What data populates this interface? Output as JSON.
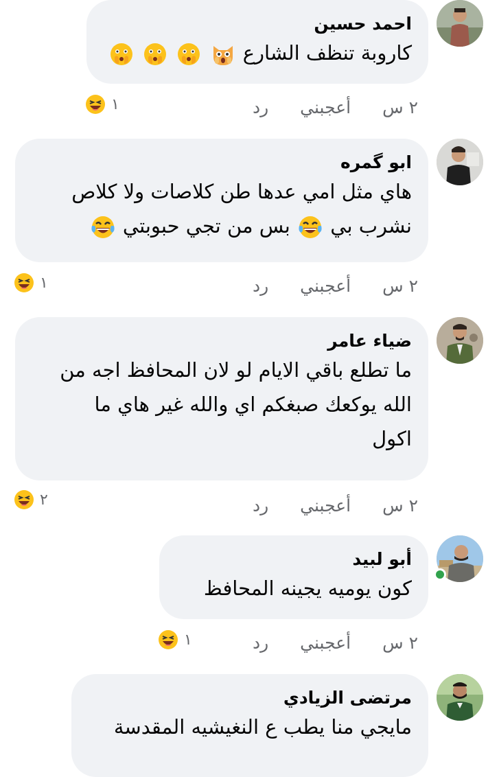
{
  "colors": {
    "bubble": "#f0f2f5",
    "meta": "#65676b",
    "online": "#31a24c"
  },
  "comments": [
    {
      "author": "احمد حسين",
      "lines": [
        "كاروبة تنظف الشارع"
      ],
      "emojis_after": [
        "shocked-cat-emoji",
        "face-hand-over-mouth-emoji",
        "face-hand-over-mouth-emoji",
        "face-hand-over-mouth-emoji"
      ],
      "time": "٢ س",
      "like": "أعجبني",
      "reply": "رد",
      "reaction_count": "١",
      "reaction_icon": "laughing-squint-emoji"
    },
    {
      "author": "ابو گمره",
      "lines": [
        "هاي مثل امي عدها طن كلاصات ولا كلاص",
        "نشرب بي",
        "بس من تجي حبوبتي"
      ],
      "emojis_inline": [
        "tears-of-joy-emoji",
        "tears-of-joy-emoji"
      ],
      "time": "٢ س",
      "like": "أعجبني",
      "reply": "رد",
      "reaction_count": "١",
      "reaction_icon": "laughing-squint-emoji"
    },
    {
      "author": "ضياء عامر",
      "lines": [
        "ما تطلع باقي الايام لو لان المحافظ اجه من",
        "الله يوكعك صبغكم اي والله غير هاي ما",
        "اكول"
      ],
      "time": "٢ س",
      "like": "أعجبني",
      "reply": "رد",
      "reaction_count": "٢",
      "reaction_icon": "laughing-squint-emoji"
    },
    {
      "author": "أبو لبيد",
      "lines": [
        "كون يوميه يجينه المحافظ"
      ],
      "time": "٢ س",
      "like": "أعجبني",
      "reply": "رد",
      "reaction_count": "١",
      "reaction_icon": "laughing-squint-emoji"
    },
    {
      "author": "مرتضى الزيادي",
      "lines": [
        "مايجي منا يطب ع النغيشيه المقدسة"
      ]
    }
  ]
}
